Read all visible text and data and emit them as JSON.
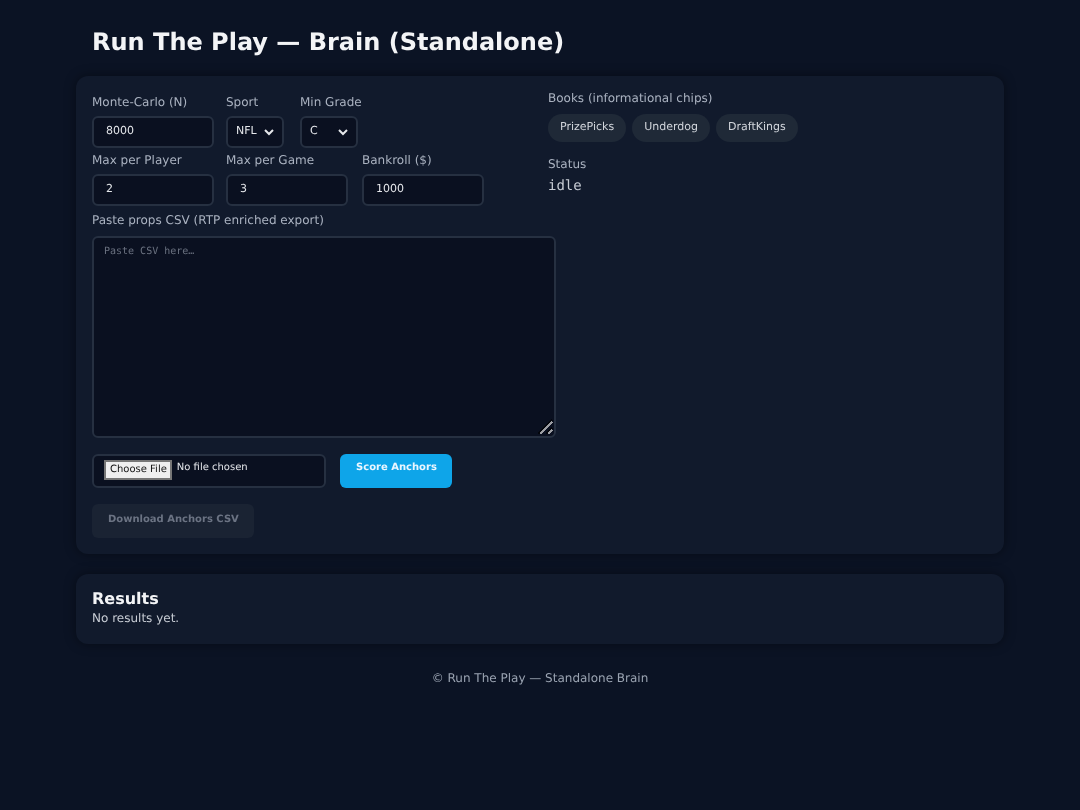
{
  "title": "Run The Play — Brain (Standalone)",
  "fields": [
    {
      "label": "Monte-Carlo (N)",
      "kind": "input",
      "value": "8000"
    },
    {
      "label": "Sport",
      "kind": "select",
      "value": "NFL"
    },
    {
      "label": "Min Grade",
      "kind": "select",
      "value": "C"
    },
    {
      "label": "Max per Player",
      "kind": "input",
      "value": "2"
    },
    {
      "label": "Max per Game",
      "kind": "input",
      "value": "3"
    },
    {
      "label": "Bankroll ($)",
      "kind": "input",
      "value": "1000"
    }
  ],
  "csv": {
    "label": "Paste props CSV (RTP enriched export)",
    "placeholder": "Paste CSV here…"
  },
  "file": {
    "button": "Choose File",
    "text": "No file chosen"
  },
  "score_button": {
    "label": "Score Anchors",
    "disabled": false
  },
  "download_button": {
    "label": "Download Anchors CSV",
    "disabled": true
  },
  "books": {
    "label": "Books (informational chips)",
    "chips": [
      "PrizePicks",
      "Underdog",
      "DraftKings"
    ]
  },
  "status": {
    "label": "Status",
    "value": "idle"
  },
  "results": {
    "title": "Results",
    "text": "No results yet."
  },
  "footer": "© Run The Play — Standalone Brain"
}
